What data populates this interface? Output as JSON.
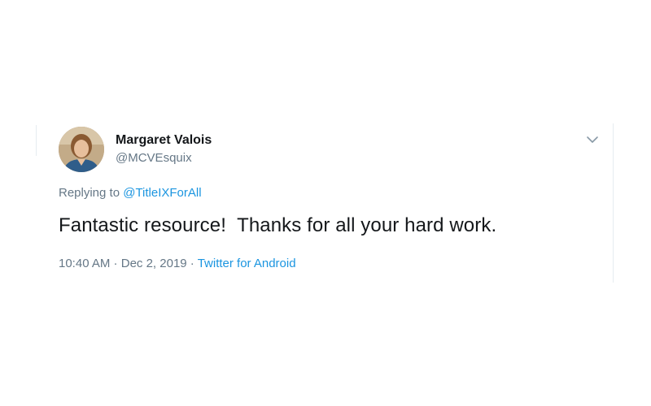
{
  "tweet": {
    "display_name": "Margaret Valois",
    "handle": "@MCVEsquix",
    "replying_prefix": "Replying to ",
    "replying_to": "@TitleIXForAll",
    "text": "Fantastic resource!  Thanks for all your hard work.",
    "time": "10:40 AM",
    "separator": " · ",
    "date": "Dec 2, 2019",
    "source": "Twitter for Android"
  },
  "icons": {
    "more": "chevron-down-icon",
    "avatar": "avatar"
  },
  "colors": {
    "link": "#1b95e0",
    "secondary_text": "#657786",
    "primary_text": "#14171a",
    "border": "#e6ecf0"
  }
}
